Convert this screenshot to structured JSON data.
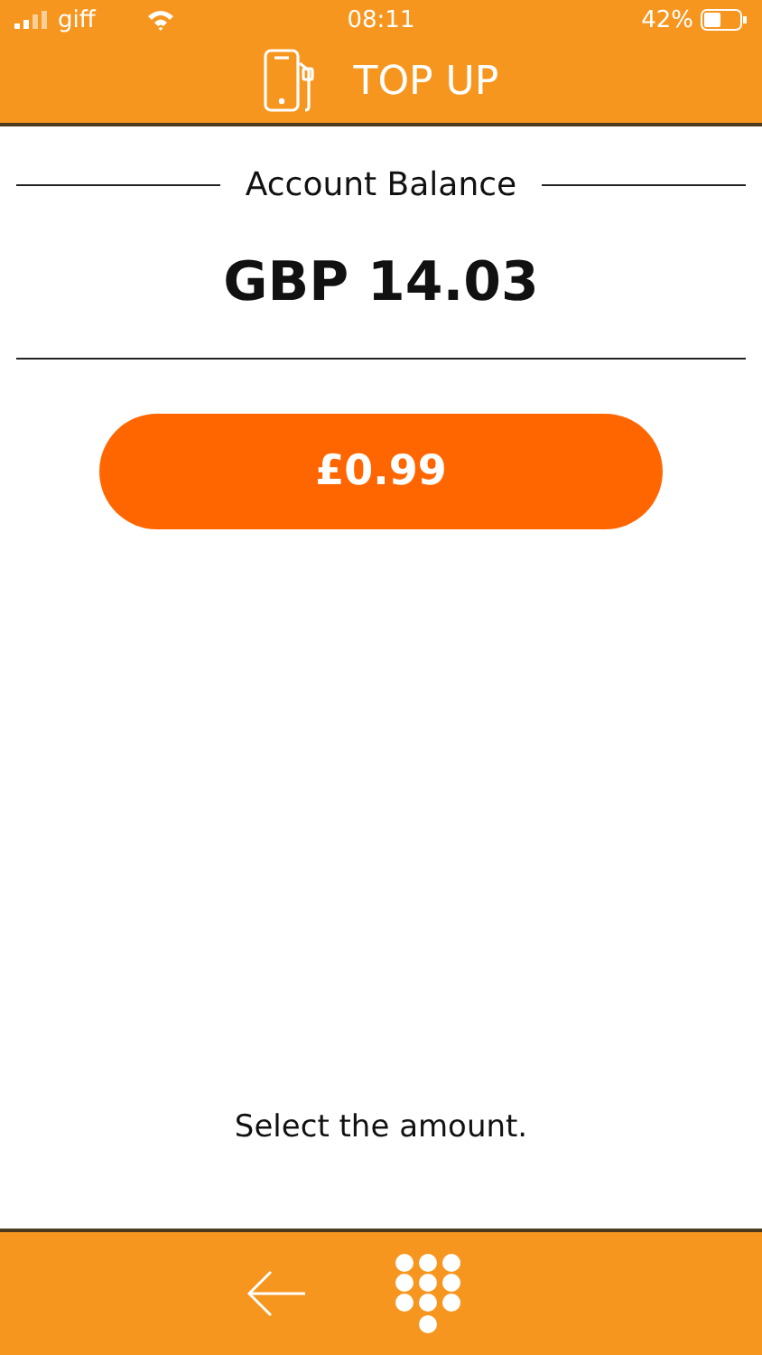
{
  "status_bar": {
    "carrier": "giff",
    "time": "08:11",
    "battery": "42%"
  },
  "header": {
    "title": "TOP UP"
  },
  "balance": {
    "label": "Account Balance",
    "value": "GBP 14.03"
  },
  "amounts": [
    {
      "label": "£0.99"
    }
  ],
  "instruction": "Select the amount."
}
